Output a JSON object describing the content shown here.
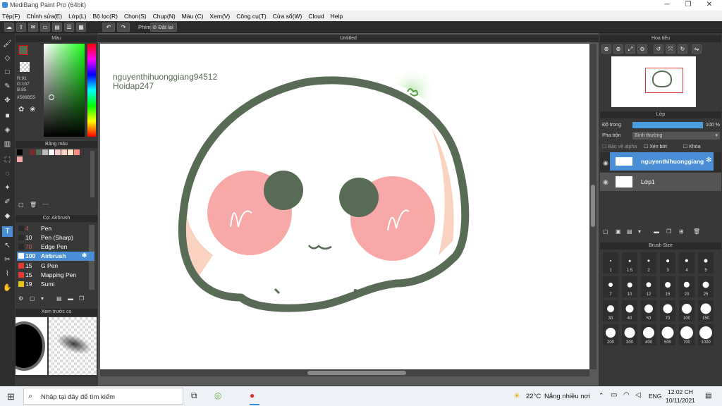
{
  "window": {
    "title": "MediBang Paint Pro (64bit)"
  },
  "menu": [
    "Tệp(F)",
    "Chỉnh sửa(E)",
    "Lớp(L)",
    "Bộ lọc(R)",
    "Chọn(S)",
    "Chụp(N)",
    "Màu (C)",
    "Xem(V)",
    "Công cụ(T)",
    "Cửa sổ(W)",
    "Cloud",
    "Help"
  ],
  "toolbar": {
    "shortcut_label": "Phím",
    "reset_label": "Đặt lại"
  },
  "color_panel": {
    "title": "Màu",
    "r": "R:91",
    "g": "G:107",
    "b": "B:85",
    "hex": "#586B55",
    "primary": "#586b55"
  },
  "palette_panel": {
    "title": "Bảng màu",
    "swatches": [
      "#000000",
      "#3a3a3a",
      "#7b2b2b",
      "#586b55",
      "#bdbdbd",
      "#ffffff",
      "#f4cccc",
      "#fad2c0",
      "#fce5cd",
      "#ff8a80",
      "#f7a8a8"
    ],
    "footer": "----"
  },
  "brush_panel": {
    "title": "Cọ: Airbrush",
    "items": [
      {
        "size": "4",
        "name": "Pen",
        "color": "#2a2a2a"
      },
      {
        "size": "10",
        "name": "Pen (Sharp)",
        "color": "#2a2a2a"
      },
      {
        "size": "70",
        "name": "Edge Pen",
        "color": "#2a2a2a"
      },
      {
        "size": "100",
        "name": "Airbrush",
        "color": "#ffffff"
      },
      {
        "size": "15",
        "name": "G Pen",
        "color": "#e53935"
      },
      {
        "size": "15",
        "name": "Mapping Pen",
        "color": "#e53935"
      },
      {
        "size": "19",
        "name": "Sumi",
        "color": "#e6c41a"
      }
    ]
  },
  "preview_panel": {
    "title": "Xem trước cọ"
  },
  "canvas": {
    "tab": "Untitled",
    "watermark_line1": "nguyenthihuonggiang94512",
    "watermark_line2": "Hoidap247"
  },
  "navigator": {
    "title": "Hoa tiêu"
  },
  "layer_panel": {
    "title": "Lớp",
    "opacity_label": "Độ trong",
    "opacity_value": "100 %",
    "blend_label": "Pha trộn",
    "blend_value": "Bình thường",
    "protect_alpha": "Bảo vệ alpha",
    "clip": "Xén bớt",
    "lock": "Khóa",
    "layers": [
      "nguyenthihuonggiang",
      "Lớp1"
    ]
  },
  "brush_size_panel": {
    "title": "Brush Size",
    "sizes": [
      "1",
      "1.5",
      "2",
      "3",
      "4",
      "5",
      "7",
      "10",
      "12",
      "15",
      "20",
      "25",
      "30",
      "40",
      "50",
      "70",
      "100",
      "150",
      "200",
      "300",
      "400",
      "500",
      "700",
      "1000"
    ]
  },
  "taskbar": {
    "search_placeholder": "Nhập tại đây để tìm kiếm",
    "weather_temp": "22°C",
    "weather_text": "Nắng nhiều nơi",
    "lang": "ENG",
    "time": "12:02 CH",
    "date": "10/11/2021"
  }
}
